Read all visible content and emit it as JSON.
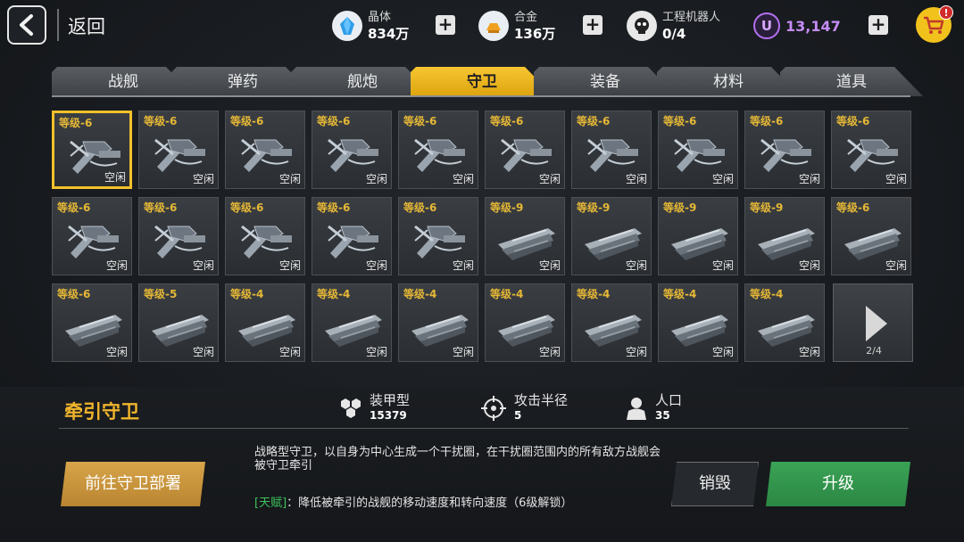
{
  "header": {
    "back_label": "返回",
    "resources": [
      {
        "name": "晶体",
        "value": "834万",
        "icon": "crystal-icon",
        "color": "#3aa8f0"
      },
      {
        "name": "合金",
        "value": "136万",
        "icon": "alloy-icon",
        "color": "#f0a020"
      },
      {
        "name": "工程机器人",
        "value": "0/4",
        "icon": "robot-icon",
        "color": "#e0e0e0"
      }
    ],
    "u_currency": {
      "icon_letter": "U",
      "value": "13,147",
      "color": "#b570f0"
    },
    "plus_label": "+",
    "cart_badge": "!"
  },
  "tabs": [
    {
      "label": "战舰",
      "active": false
    },
    {
      "label": "弹药",
      "active": false
    },
    {
      "label": "舰炮",
      "active": false
    },
    {
      "label": "守卫",
      "active": true
    },
    {
      "label": "装备",
      "active": false
    },
    {
      "label": "材料",
      "active": false
    },
    {
      "label": "道具",
      "active": false
    }
  ],
  "grid": {
    "status_label": "空闲",
    "items": [
      {
        "level": "等级-6",
        "type": "tractor",
        "selected": true
      },
      {
        "level": "等级-6",
        "type": "tractor"
      },
      {
        "level": "等级-6",
        "type": "tractor"
      },
      {
        "level": "等级-6",
        "type": "tractor"
      },
      {
        "level": "等级-6",
        "type": "tractor"
      },
      {
        "level": "等级-6",
        "type": "tractor"
      },
      {
        "level": "等级-6",
        "type": "tractor"
      },
      {
        "level": "等级-6",
        "type": "tractor"
      },
      {
        "level": "等级-6",
        "type": "tractor"
      },
      {
        "level": "等级-6",
        "type": "tractor"
      },
      {
        "level": "等级-6",
        "type": "tractor"
      },
      {
        "level": "等级-6",
        "type": "tractor"
      },
      {
        "level": "等级-6",
        "type": "tractor"
      },
      {
        "level": "等级-6",
        "type": "tractor"
      },
      {
        "level": "等级-6",
        "type": "tractor"
      },
      {
        "level": "等级-9",
        "type": "cannon"
      },
      {
        "level": "等级-9",
        "type": "cannon"
      },
      {
        "level": "等级-9",
        "type": "cannon"
      },
      {
        "level": "等级-9",
        "type": "cannon"
      },
      {
        "level": "等级-6",
        "type": "cannon"
      },
      {
        "level": "等级-6",
        "type": "cannon"
      },
      {
        "level": "等级-5",
        "type": "cannon"
      },
      {
        "level": "等级-4",
        "type": "cannon"
      },
      {
        "level": "等级-4",
        "type": "cannon"
      },
      {
        "level": "等级-4",
        "type": "cannon"
      },
      {
        "level": "等级-4",
        "type": "cannon"
      },
      {
        "level": "等级-4",
        "type": "cannon"
      },
      {
        "level": "等级-4",
        "type": "cannon"
      },
      {
        "level": "等级-4",
        "type": "cannon"
      }
    ],
    "page_indicator": "2/4"
  },
  "detail": {
    "name": "牵引守卫",
    "stats": [
      {
        "label": "装甲型",
        "value": "15379",
        "icon": "armor-hex-icon"
      },
      {
        "label": "攻击半径",
        "value": "5",
        "icon": "crosshair-icon"
      },
      {
        "label": "人口",
        "value": "35",
        "icon": "population-icon"
      }
    ],
    "description": "战略型守卫，以自身为中心生成一个干扰圈，在干扰圈范围内的所有敌方战舰会被守卫牵引",
    "talent_tag": "[天赋]",
    "talent_text": "：降低被牵引的战舰的移动速度和转向速度（6级解锁）",
    "deploy_label": "前往守卫部署",
    "destroy_label": "销毁",
    "upgrade_label": "升级"
  }
}
